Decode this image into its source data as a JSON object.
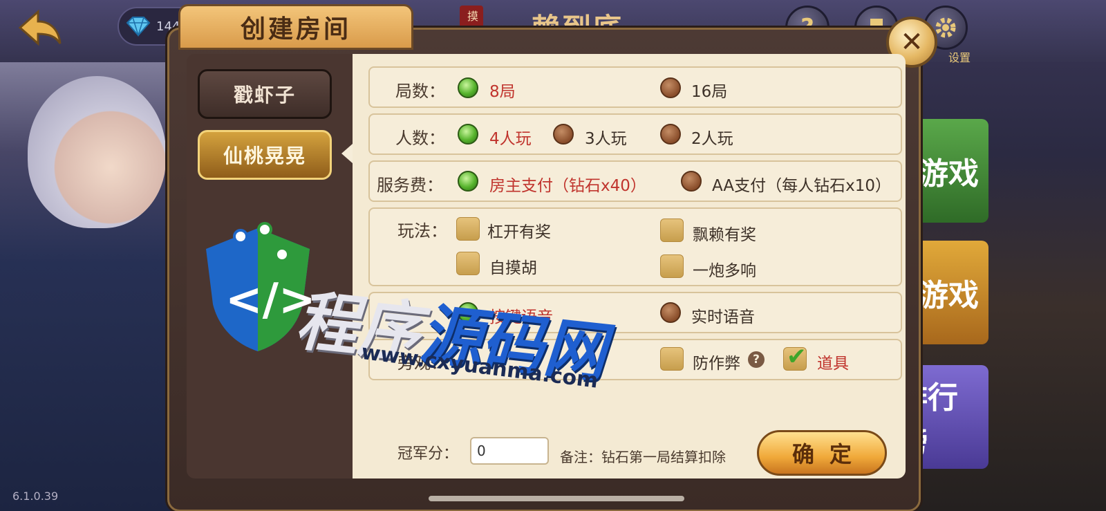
{
  "background": {
    "gem_count": "144",
    "mode_badge": "摸一把",
    "mode_title": "一赖到底",
    "settings_label": "设置",
    "side_buttons": [
      "游戏",
      "游戏",
      "排行榜"
    ],
    "version": "6.1.0.39"
  },
  "dialog": {
    "title": "创建房间",
    "close_label": "✕",
    "tabs": [
      {
        "label": "戳虾子",
        "active": false
      },
      {
        "label": "仙桃晃晃",
        "active": true
      }
    ],
    "rounds": {
      "label": "局数：",
      "options": [
        {
          "text": "8局",
          "selected": true
        },
        {
          "text": "16局",
          "selected": false
        }
      ]
    },
    "players": {
      "label": "人数：",
      "options": [
        {
          "text": "4人玩",
          "selected": true
        },
        {
          "text": "3人玩",
          "selected": false
        },
        {
          "text": "2人玩",
          "selected": false
        }
      ]
    },
    "fee": {
      "label": "服务费：",
      "options": [
        {
          "text": "房主支付（钻石x40）",
          "selected": true
        },
        {
          "text": "AA支付（每人钻石x10）",
          "selected": false
        }
      ]
    },
    "rules": {
      "label": "玩法：",
      "options": [
        {
          "text": "杠开有奖",
          "checked": false
        },
        {
          "text": "飘赖有奖",
          "checked": false
        },
        {
          "text": "自摸胡",
          "checked": false
        },
        {
          "text": "一炮多响",
          "checked": false
        }
      ]
    },
    "voice": {
      "options": [
        {
          "text": "按键语音",
          "selected": true
        },
        {
          "text": "实时语音",
          "selected": false
        }
      ]
    },
    "spectate": {
      "label": "旁观：",
      "options": [
        {
          "text": "防作弊",
          "checked": false,
          "help": "?"
        },
        {
          "text": "道具",
          "checked": true
        }
      ]
    },
    "score": {
      "label": "冠军分：",
      "value": "0"
    },
    "note": "备注：钻石第一局结算扣除",
    "confirm_label": "确定"
  },
  "watermark": {
    "text_part1": "程序",
    "text_part2": "源码网",
    "url": "www.cxyuanma.com"
  },
  "colors": {
    "selected_text": "#c0342d",
    "radio_on": "#56b32c",
    "panel_bg": "#f4ead3",
    "accent_gold": "#f0a93a"
  }
}
